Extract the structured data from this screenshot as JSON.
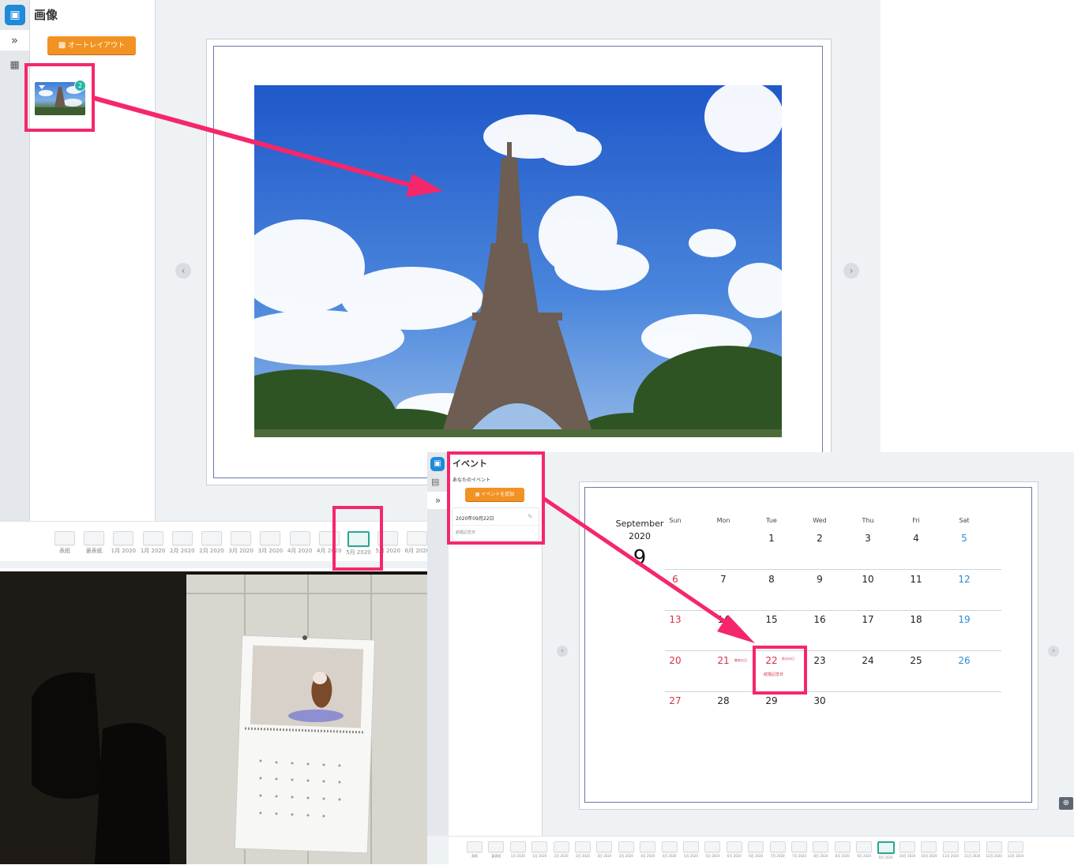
{
  "top_editor": {
    "panel_title": "画像",
    "auto_layout_label": "オートレイアウト",
    "photo_count_badge": "2",
    "page_strip": [
      "表紙",
      "裏表紙",
      "1月 2020",
      "1月 2020",
      "2月 2020",
      "2月 2020",
      "3月 2020",
      "3月 2020",
      "4月 2020",
      "4月 2020",
      "5月 2020",
      "5月 2020",
      "6月 2020"
    ],
    "selected_index": 10
  },
  "bottom_editor": {
    "panel_title": "イベント",
    "your_events_label": "あなたのイベント",
    "add_event_label": "イベントを追加",
    "event_date": "2020年09月22日",
    "event_name": "結婚記念日",
    "calendar": {
      "month_name": "September",
      "year": "2020",
      "month_number": "9",
      "weekdays": [
        "Sun",
        "Mon",
        "Tue",
        "Wed",
        "Thu",
        "Fri",
        "Sat"
      ],
      "weeks": [
        [
          "",
          "",
          "1",
          "2",
          "3",
          "4",
          "5"
        ],
        [
          "6",
          "7",
          "8",
          "9",
          "10",
          "11",
          "12"
        ],
        [
          "13",
          "14",
          "15",
          "16",
          "17",
          "18",
          "19"
        ],
        [
          "20",
          "21",
          "22",
          "23",
          "24",
          "25",
          "26"
        ],
        [
          "27",
          "28",
          "29",
          "30",
          "",
          "",
          ""
        ]
      ],
      "holiday_notes": {
        "d21": "敬老の日",
        "d22_small": "秋分の日",
        "d22_event": "結婚記念日"
      }
    },
    "page_strip": [
      "表紙",
      "裏表紙",
      "1月 2020",
      "1月 2020",
      "2月 2020",
      "2月 2020",
      "3月 2020",
      "3月 2020",
      "4月 2020",
      "4月 2020",
      "5月 2020",
      "5月 2020",
      "6月 2020",
      "6月 2020",
      "7月 2020",
      "7月 2020",
      "8月 2020",
      "8月 2020",
      "9月 2020",
      "9月 2020",
      "10月 2020",
      "10月 2020",
      "11月 2020",
      "11月 2020",
      "12月 2020",
      "12月 2020"
    ],
    "selected_index": 19
  },
  "colors": {
    "accent_orange": "#f29222",
    "highlight_pink": "#f5276a",
    "brand_blue": "#1f8bd8",
    "selected_teal": "#2aa597",
    "sunday_red": "#d6304a",
    "saturday_blue": "#2e8bd0"
  }
}
